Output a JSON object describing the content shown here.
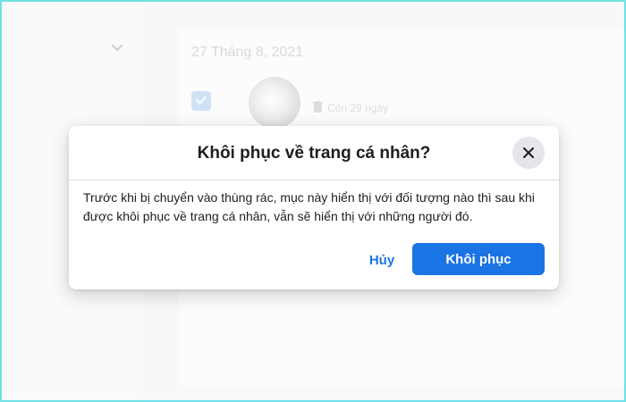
{
  "background": {
    "date": "27 Tháng 8, 2021",
    "checkbox_icon": "check-icon",
    "remaining": "Còn 29 ngày",
    "trash_icon": "trash-icon",
    "collapse_icon": "chevron-down-icon"
  },
  "dialog": {
    "title": "Khôi phục về trang cá nhân?",
    "message": "Trước khi bị chuyển vào thùng rác, mục này hiển thị với đối tượng nào thì sau khi được khôi phục về trang cá nhân, vẫn sẽ hiển thị với những người đó.",
    "cancel_label": "Hủy",
    "confirm_label": "Khôi phục",
    "close_icon": "close-icon"
  },
  "colors": {
    "accent": "#1b74e4",
    "frame": "#22d3d8"
  }
}
